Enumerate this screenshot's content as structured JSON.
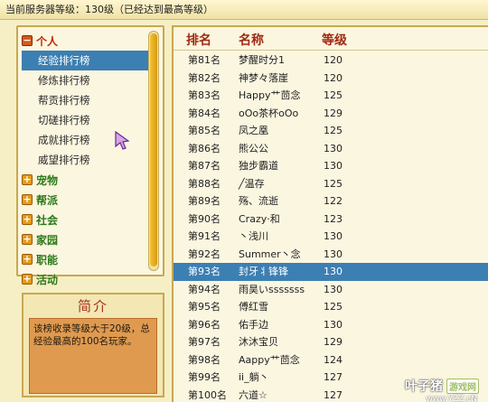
{
  "topbar": {
    "text": "当前服务器等级：130级（已经达到最高等级）"
  },
  "tree": {
    "personal": {
      "label": "个人",
      "items": [
        "经验排行榜",
        "修炼排行榜",
        "帮贡排行榜",
        "切磋排行榜",
        "成就排行榜",
        "威望排行榜"
      ],
      "selected_index": 0
    },
    "categories": [
      "宠物",
      "帮派",
      "社会",
      "家园",
      "职能",
      "活动"
    ]
  },
  "intro": {
    "title": "简介",
    "body": "该榜收录等级大于20级，总经验最高的100名玩家。"
  },
  "table": {
    "headers": [
      "排名",
      "名称",
      "等级"
    ],
    "rows": [
      [
        "第81名",
        "梦醒时分1",
        "120"
      ],
      [
        "第82名",
        "神梦々落崖",
        "120"
      ],
      [
        "第83名",
        "Happy艹茴念",
        "125"
      ],
      [
        "第84名",
        "oOo茶杯oOo",
        "129"
      ],
      [
        "第85名",
        "凤之凰",
        "125"
      ],
      [
        "第86名",
        "熊公公",
        "130"
      ],
      [
        "第87名",
        "独步霸道",
        "130"
      ],
      [
        "第88名",
        "╱温存",
        "125"
      ],
      [
        "第89名",
        "殇、流逝",
        "122"
      ],
      [
        "第90名",
        "Crazy·和",
        "123"
      ],
      [
        "第91名",
        "丶浅川",
        "130"
      ],
      [
        "第92名",
        "Summer丶念",
        "130"
      ],
      [
        "第93名",
        "封牙丬锋锋",
        "130"
      ],
      [
        "第94名",
        "雨昊いsssssss",
        "130"
      ],
      [
        "第95名",
        "傅红雪",
        "125"
      ],
      [
        "第96名",
        "佑手边",
        "130"
      ],
      [
        "第97名",
        "沐沐宝贝",
        "129"
      ],
      [
        "第98名",
        "Aappy艹茴念",
        "124"
      ],
      [
        "第99名",
        "ii_躺丶",
        "127"
      ],
      [
        "第100名",
        "六道☆",
        "127"
      ]
    ],
    "selected_row": 12
  },
  "watermark": {
    "brand": "叶子猪",
    "badge": "游戏网",
    "url": "www.YZZ.cN"
  },
  "colors": {
    "selected": "#3c7fb2",
    "header": "#a02a12",
    "accent": "#c8a850"
  }
}
